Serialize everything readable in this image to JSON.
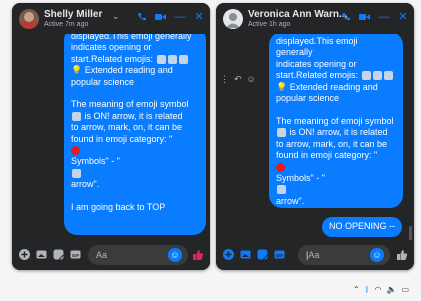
{
  "chat1": {
    "name": "Shelly Miller",
    "status": "Active 7m ago",
    "message": {
      "line0": "displayed.This emoji generally",
      "line1": "indicates opening or",
      "line2": "start.Related emojis:",
      "line3": "Extended reading and",
      "line4": "popular science",
      "line5": "The meaning of emoji symbol",
      "line6": "is ON! arrow, it is related",
      "line7": "to arrow, mark, on, it can be",
      "line8": "found in emoji category: \"",
      "line9": "Symbols\" - \"",
      "line10": "arrow\".",
      "line11": "I am going back to TOP"
    },
    "input_placeholder": "Aa"
  },
  "chat2": {
    "name": "Veronica Ann Warn...",
    "status": "Active 1h ago",
    "message": {
      "line0": "displayed.This emoji generally",
      "line1": "indicates opening or",
      "line2": "start.Related emojis:",
      "line3": "Extended reading and",
      "line4": "popular science",
      "line5": "The meaning of emoji symbol",
      "line6": "is ON! arrow, it is related",
      "line7": "to arrow, mark, on, it can be",
      "line8": "found in emoji category: \"",
      "line9": "Symbols\" - \"",
      "line10": "arrow\"."
    },
    "reply": "NO OPENING --",
    "input_placeholder": "Aa"
  },
  "colors": {
    "panel": "#242526",
    "bubble": "#0a7cff",
    "accent": "#0a7cff",
    "text": "#e4e6eb"
  },
  "icons": [
    "phone-icon",
    "video-icon",
    "minimize-icon",
    "close-icon",
    "plus-icon",
    "photo-icon",
    "sticker-icon",
    "gif-icon",
    "emoji-icon",
    "like-icon"
  ]
}
